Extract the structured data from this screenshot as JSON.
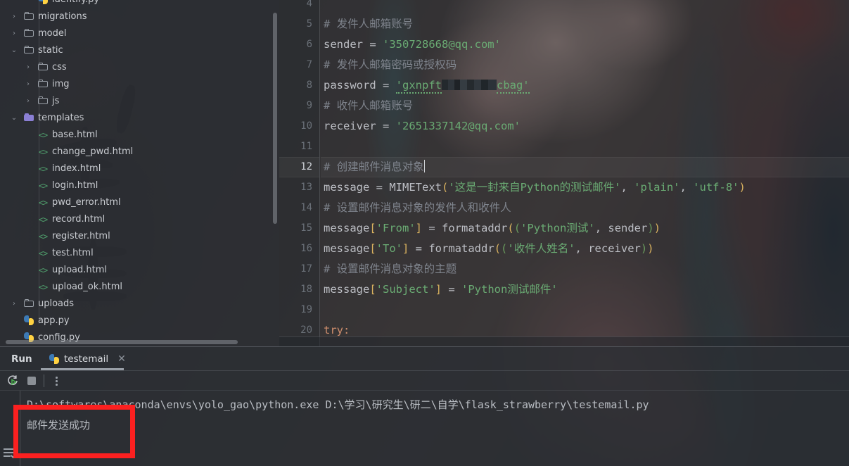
{
  "app": {
    "theme_accent": "#fb2020",
    "background": "#2b2e33"
  },
  "project_tree": {
    "indent_guide": true,
    "items": [
      {
        "label": "identify.py",
        "icon": "python-file-icon",
        "indent": 2,
        "chevron": "",
        "type": "py",
        "clipped_top": true
      },
      {
        "label": "migrations",
        "icon": "folder-icon",
        "indent": 1,
        "chevron": "›",
        "type": "folder"
      },
      {
        "label": "model",
        "icon": "folder-icon",
        "indent": 1,
        "chevron": "›",
        "type": "folder"
      },
      {
        "label": "static",
        "icon": "folder-icon",
        "indent": 1,
        "chevron": "⌄",
        "type": "folder"
      },
      {
        "label": "css",
        "icon": "folder-icon",
        "indent": 2,
        "chevron": "›",
        "type": "folder"
      },
      {
        "label": "img",
        "icon": "folder-icon",
        "indent": 2,
        "chevron": "›",
        "type": "folder"
      },
      {
        "label": "js",
        "icon": "folder-icon",
        "indent": 2,
        "chevron": "›",
        "type": "folder"
      },
      {
        "label": "templates",
        "icon": "folder-open-icon",
        "indent": 1,
        "chevron": "⌄",
        "type": "folder-selected"
      },
      {
        "label": "base.html",
        "icon": "html-file-icon",
        "indent": 2,
        "chevron": "",
        "type": "html"
      },
      {
        "label": "change_pwd.html",
        "icon": "html-file-icon",
        "indent": 2,
        "chevron": "",
        "type": "html"
      },
      {
        "label": "index.html",
        "icon": "html-file-icon",
        "indent": 2,
        "chevron": "",
        "type": "html"
      },
      {
        "label": "login.html",
        "icon": "html-file-icon",
        "indent": 2,
        "chevron": "",
        "type": "html"
      },
      {
        "label": "pwd_error.html",
        "icon": "html-file-icon",
        "indent": 2,
        "chevron": "",
        "type": "html"
      },
      {
        "label": "record.html",
        "icon": "html-file-icon",
        "indent": 2,
        "chevron": "",
        "type": "html"
      },
      {
        "label": "register.html",
        "icon": "html-file-icon",
        "indent": 2,
        "chevron": "",
        "type": "html"
      },
      {
        "label": "test.html",
        "icon": "html-file-icon",
        "indent": 2,
        "chevron": "",
        "type": "html"
      },
      {
        "label": "upload.html",
        "icon": "html-file-icon",
        "indent": 2,
        "chevron": "",
        "type": "html"
      },
      {
        "label": "upload_ok.html",
        "icon": "html-file-icon",
        "indent": 2,
        "chevron": "",
        "type": "html"
      },
      {
        "label": "uploads",
        "icon": "folder-icon",
        "indent": 1,
        "chevron": "›",
        "type": "folder"
      },
      {
        "label": "app.py",
        "icon": "python-file-icon",
        "indent": 1,
        "chevron": "",
        "type": "py"
      },
      {
        "label": "config.py",
        "icon": "python-file-icon",
        "indent": 1,
        "chevron": "",
        "type": "py",
        "clipped_bottom": true
      }
    ]
  },
  "editor": {
    "current_line": 12,
    "first_visible_line": 4,
    "lines": [
      {
        "n": "4",
        "segments": []
      },
      {
        "n": "5",
        "segments": [
          {
            "t": "comment",
            "v": "# 发件人邮箱账号"
          }
        ]
      },
      {
        "n": "6",
        "segments": [
          {
            "t": "id",
            "v": "sender"
          },
          {
            "t": "op",
            "v": " = "
          },
          {
            "t": "str",
            "v": "'350728668@qq.com'"
          }
        ]
      },
      {
        "n": "7",
        "segments": [
          {
            "t": "comment",
            "v": "# 发件人邮箱密码或授权码"
          }
        ]
      },
      {
        "n": "8",
        "segments": [
          {
            "t": "id",
            "v": "password"
          },
          {
            "t": "op",
            "v": " = "
          },
          {
            "t": "str-spell-start",
            "v": "'gxnpft"
          },
          {
            "t": "censor",
            "v": ""
          },
          {
            "t": "str-spell-end",
            "v": "cbag'"
          }
        ]
      },
      {
        "n": "9",
        "segments": [
          {
            "t": "comment",
            "v": "# 收件人邮箱账号"
          }
        ]
      },
      {
        "n": "10",
        "segments": [
          {
            "t": "id",
            "v": "receiver"
          },
          {
            "t": "op",
            "v": " = "
          },
          {
            "t": "str",
            "v": "'2651337142@qq.com'"
          }
        ]
      },
      {
        "n": "11",
        "segments": []
      },
      {
        "n": "12",
        "segments": [
          {
            "t": "comment",
            "v": "# 创建邮件消息对象"
          },
          {
            "t": "caret",
            "v": ""
          }
        ]
      },
      {
        "n": "13",
        "segments": [
          {
            "t": "id",
            "v": "message"
          },
          {
            "t": "op",
            "v": " = "
          },
          {
            "t": "fn",
            "v": "MIMEText"
          },
          {
            "t": "br",
            "v": "("
          },
          {
            "t": "str",
            "v": "'这是一封来自Python的测试邮件'"
          },
          {
            "t": "op",
            "v": ", "
          },
          {
            "t": "str",
            "v": "'plain'"
          },
          {
            "t": "op",
            "v": ", "
          },
          {
            "t": "str",
            "v": "'utf-8'"
          },
          {
            "t": "br",
            "v": ")"
          }
        ]
      },
      {
        "n": "14",
        "segments": [
          {
            "t": "comment",
            "v": "# 设置邮件消息对象的发件人和收件人"
          }
        ]
      },
      {
        "n": "15",
        "segments": [
          {
            "t": "id",
            "v": "message"
          },
          {
            "t": "br",
            "v": "["
          },
          {
            "t": "str",
            "v": "'From'"
          },
          {
            "t": "br",
            "v": "]"
          },
          {
            "t": "op",
            "v": " = "
          },
          {
            "t": "fn",
            "v": "formataddr"
          },
          {
            "t": "br",
            "v": "("
          },
          {
            "t": "br2",
            "v": "("
          },
          {
            "t": "str",
            "v": "'Python测试'"
          },
          {
            "t": "op",
            "v": ", "
          },
          {
            "t": "id",
            "v": "sender"
          },
          {
            "t": "br2",
            "v": ")"
          },
          {
            "t": "br",
            "v": ")"
          }
        ]
      },
      {
        "n": "16",
        "segments": [
          {
            "t": "id",
            "v": "message"
          },
          {
            "t": "br",
            "v": "["
          },
          {
            "t": "str",
            "v": "'To'"
          },
          {
            "t": "br",
            "v": "]"
          },
          {
            "t": "op",
            "v": " = "
          },
          {
            "t": "fn",
            "v": "formataddr"
          },
          {
            "t": "br",
            "v": "("
          },
          {
            "t": "br2",
            "v": "("
          },
          {
            "t": "str",
            "v": "'收件人姓名'"
          },
          {
            "t": "op",
            "v": ", "
          },
          {
            "t": "id",
            "v": "receiver"
          },
          {
            "t": "br2",
            "v": ")"
          },
          {
            "t": "br",
            "v": ")"
          }
        ]
      },
      {
        "n": "17",
        "segments": [
          {
            "t": "comment",
            "v": "# 设置邮件消息对象的主题"
          }
        ]
      },
      {
        "n": "18",
        "segments": [
          {
            "t": "id",
            "v": "message"
          },
          {
            "t": "br",
            "v": "["
          },
          {
            "t": "str",
            "v": "'Subject'"
          },
          {
            "t": "br",
            "v": "]"
          },
          {
            "t": "op",
            "v": " = "
          },
          {
            "t": "str",
            "v": "'Python测试邮件'"
          }
        ]
      },
      {
        "n": "19",
        "segments": []
      },
      {
        "n": "20",
        "segments": [
          {
            "t": "kw",
            "v": "try:"
          }
        ],
        "clipped": true
      }
    ]
  },
  "run_panel": {
    "title": "Run",
    "tab": {
      "label": "testemail",
      "icon": "python-file-icon",
      "close_icon": "close-icon"
    },
    "toolbar": [
      {
        "name": "rerun-icon",
        "tooltip": "Rerun"
      },
      {
        "name": "stop-icon",
        "tooltip": "Stop"
      },
      {
        "name": "more-icon",
        "tooltip": "More"
      }
    ],
    "console": {
      "gutter_icon": "soft-wrap-icon",
      "lines": [
        "D:\\softwares\\anaconda\\envs\\yolo_gao\\python.exe D:\\学习\\研究生\\研二\\自学\\flask_strawberry\\testemail.py",
        "邮件发送成功"
      ]
    }
  },
  "annotation": {
    "shape": "rectangle",
    "color": "#fb2020",
    "target": "console-output"
  }
}
